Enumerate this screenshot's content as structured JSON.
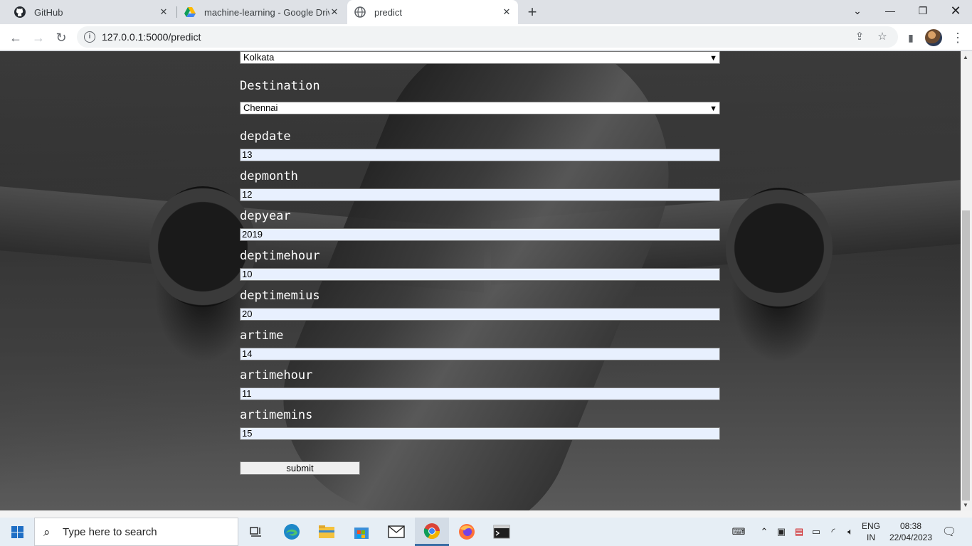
{
  "browser": {
    "tabs": [
      {
        "title": "GitHub",
        "icon": "github-icon"
      },
      {
        "title": "machine-learning - Google Drive",
        "icon": "google-drive-icon"
      },
      {
        "title": "predict",
        "icon": "globe-icon",
        "active": true
      }
    ],
    "url": "127.0.0.1:5000/predict"
  },
  "form": {
    "source_value": "Kolkata",
    "destination_label": "Destination",
    "destination_value": "Chennai",
    "fields": [
      {
        "label": "depdate",
        "value": "13"
      },
      {
        "label": "depmonth",
        "value": "12"
      },
      {
        "label": "depyear",
        "value": "2019"
      },
      {
        "label": "deptimehour",
        "value": "10"
      },
      {
        "label": "deptimemius",
        "value": "20"
      },
      {
        "label": "artime",
        "value": "14"
      },
      {
        "label": "artimehour",
        "value": "11"
      },
      {
        "label": "artimemins",
        "value": "15"
      }
    ],
    "submit_label": "submit"
  },
  "taskbar": {
    "search_placeholder": "Type here to search",
    "lang_line1": "ENG",
    "lang_line2": "IN",
    "time": "08:38",
    "date": "22/04/2023"
  },
  "colors": {
    "input_fill": "#e8f0fe",
    "label_text": "#ffffff",
    "tabstrip": "#dee1e6"
  }
}
